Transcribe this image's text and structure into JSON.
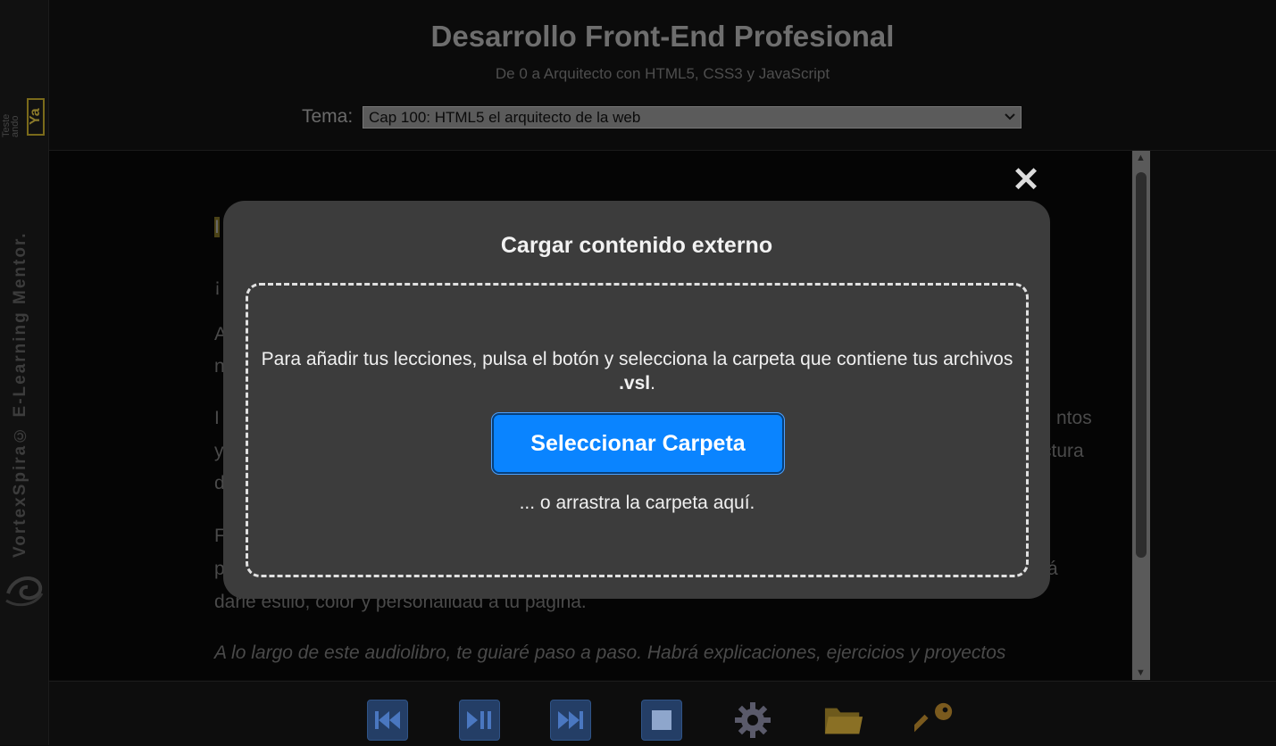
{
  "header": {
    "title": "Desarrollo Front-End Profesional",
    "subtitle": "De 0 a Arquitecto con HTML5, CSS3 y JavaScript",
    "tema_label": "Tema:",
    "tema_selected": "Cap 100: HTML5 el arquitecto de la web"
  },
  "sidebar": {
    "brand_small_text": "Teste ando",
    "brand_small_ya": "Ya",
    "vertical_brand": "VortexSpira© E-Learning Mentor."
  },
  "content": {
    "line1_visible": "I",
    "line2_visible": "¡",
    "line3_visible": "A",
    "line4_visible": "n",
    "line5_left": "I",
    "line5_right": "ntos",
    "line6_left": "y",
    "line6_right": "ctura",
    "line7_left": "d",
    "line8_left": "F",
    "line9_left": "p",
    "line9_right": "á",
    "line10": "darle estilo, color y personalidad a tu página.",
    "line11": "A lo largo de este audiolibro, te guiaré paso a paso. Habrá explicaciones, ejercicios y proyectos"
  },
  "modal": {
    "close_symbol": "✕",
    "title": "Cargar contenido externo",
    "instructions_pre": "Para añadir tus lecciones, pulsa el botón y selecciona la carpeta que contiene tus archivos ",
    "instructions_ext": ".vsl",
    "instructions_post": ".",
    "select_button": "Seleccionar Carpeta",
    "drag_text": "... o arrastra la carpeta aquí."
  },
  "footer": {
    "buttons": [
      "rewind-icon",
      "play-pause-icon",
      "fast-forward-icon",
      "stop-icon",
      "gear-icon",
      "folder-icon",
      "key-icon"
    ]
  },
  "colors": {
    "accent": "#0a84ff",
    "modal_bg": "#3c3c3c",
    "footer_button_bg": "#243e66",
    "highlight": "#4a4216"
  }
}
